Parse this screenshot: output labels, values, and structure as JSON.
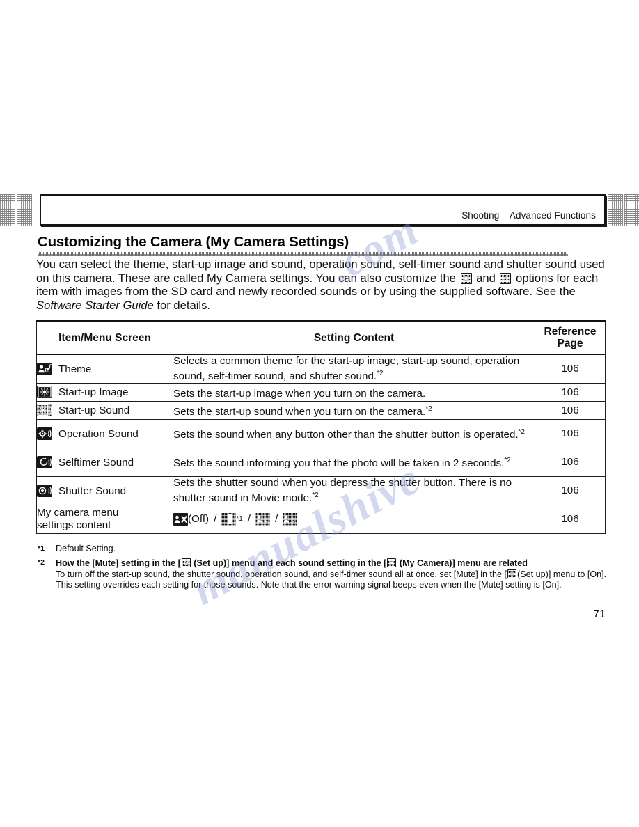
{
  "header": {
    "running_head": "Shooting – Advanced Functions"
  },
  "section": {
    "title": "Customizing the Camera (My Camera Settings)",
    "intro_part1": "You can select the theme, start-up image and sound, operation sound, self-timer sound and shutter sound used on this camera. These are called My Camera settings. You can also customize the",
    "intro_and": "and",
    "intro_part2": "options for each item with images from the SD card and newly recorded sounds or by using the supplied software. See the",
    "intro_italic": "Software Starter Guide",
    "intro_part3": "for details."
  },
  "table": {
    "headers": {
      "item": "Item/Menu Screen",
      "content": "Setting Content",
      "reference_line1": "Reference",
      "reference_line2": "Page"
    },
    "rows": [
      {
        "icon": "theme-icon",
        "label": "Theme",
        "content": "Selects a common theme for the start-up image, start-up sound, operation sound, self-timer sound, and shutter sound.",
        "content_sup": "*2",
        "reference": "106"
      },
      {
        "icon": "startup-image-icon",
        "label": "Start-up Image",
        "content": "Sets the start-up image when you turn on the camera.",
        "content_sup": "",
        "reference": "106"
      },
      {
        "icon": "startup-sound-icon",
        "label": "Start-up Sound",
        "content": "Sets the start-up sound when you turn on the camera.",
        "content_sup": "*2",
        "reference": "106"
      },
      {
        "icon": "operation-sound-icon",
        "label": "Operation Sound",
        "content": "Sets the sound when any button other than the shutter button is operated.",
        "content_sup": "*2",
        "reference": "106"
      },
      {
        "icon": "selftimer-sound-icon",
        "label": "Selftimer Sound",
        "content": "Sets the sound informing you that the photo will be taken in 2 seconds.",
        "content_sup": "*2",
        "reference": "106"
      },
      {
        "icon": "shutter-sound-icon",
        "label": "Shutter Sound",
        "content": "Sets the shutter sound when you depress the shutter button. There is no shutter sound in Movie mode.",
        "content_sup": "*2",
        "reference": "106"
      }
    ],
    "last_row": {
      "label_line1": "My camera menu",
      "label_line2": "settings content",
      "option_off_text": "(Off)",
      "option_default_sup": "*1",
      "separator": "/",
      "reference": "106"
    }
  },
  "footnotes": {
    "mark1": "*1",
    "note1": "Default Setting.",
    "mark2": "*2",
    "note2_head_a": "How the [Mute] setting in the [",
    "note2_head_b": "(Set up)] menu and each sound setting in the [",
    "note2_head_c": "(My Camera)] menu are related",
    "note2_body_a": "To turn off the start-up sound, the shutter sound, operation sound, and self-timer sound all at once, set [Mute] in the",
    "note2_body_b": "(Set up)] menu to [On]. This setting overrides each setting for those sounds. Note that the error warning signal beeps even when the [Mute] setting is [On]."
  },
  "page_number": "71",
  "watermark": {
    "line1": "manualshive",
    "line2": ".com"
  }
}
